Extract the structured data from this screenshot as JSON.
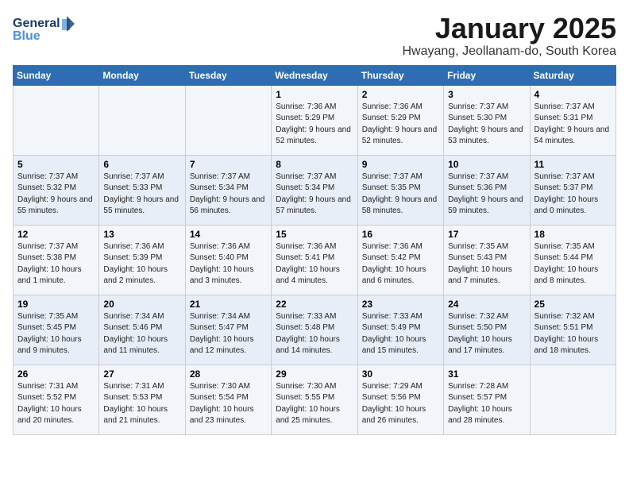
{
  "header": {
    "logo_line1": "General",
    "logo_line2": "Blue",
    "title": "January 2025",
    "subtitle": "Hwayang, Jeollanam-do, South Korea"
  },
  "weekdays": [
    "Sunday",
    "Monday",
    "Tuesday",
    "Wednesday",
    "Thursday",
    "Friday",
    "Saturday"
  ],
  "weeks": [
    [
      {
        "day": "",
        "info": ""
      },
      {
        "day": "",
        "info": ""
      },
      {
        "day": "",
        "info": ""
      },
      {
        "day": "1",
        "info": "Sunrise: 7:36 AM\nSunset: 5:29 PM\nDaylight: 9 hours and 52 minutes."
      },
      {
        "day": "2",
        "info": "Sunrise: 7:36 AM\nSunset: 5:29 PM\nDaylight: 9 hours and 52 minutes."
      },
      {
        "day": "3",
        "info": "Sunrise: 7:37 AM\nSunset: 5:30 PM\nDaylight: 9 hours and 53 minutes."
      },
      {
        "day": "4",
        "info": "Sunrise: 7:37 AM\nSunset: 5:31 PM\nDaylight: 9 hours and 54 minutes."
      }
    ],
    [
      {
        "day": "5",
        "info": "Sunrise: 7:37 AM\nSunset: 5:32 PM\nDaylight: 9 hours and 55 minutes."
      },
      {
        "day": "6",
        "info": "Sunrise: 7:37 AM\nSunset: 5:33 PM\nDaylight: 9 hours and 55 minutes."
      },
      {
        "day": "7",
        "info": "Sunrise: 7:37 AM\nSunset: 5:34 PM\nDaylight: 9 hours and 56 minutes."
      },
      {
        "day": "8",
        "info": "Sunrise: 7:37 AM\nSunset: 5:34 PM\nDaylight: 9 hours and 57 minutes."
      },
      {
        "day": "9",
        "info": "Sunrise: 7:37 AM\nSunset: 5:35 PM\nDaylight: 9 hours and 58 minutes."
      },
      {
        "day": "10",
        "info": "Sunrise: 7:37 AM\nSunset: 5:36 PM\nDaylight: 9 hours and 59 minutes."
      },
      {
        "day": "11",
        "info": "Sunrise: 7:37 AM\nSunset: 5:37 PM\nDaylight: 10 hours and 0 minutes."
      }
    ],
    [
      {
        "day": "12",
        "info": "Sunrise: 7:37 AM\nSunset: 5:38 PM\nDaylight: 10 hours and 1 minute."
      },
      {
        "day": "13",
        "info": "Sunrise: 7:36 AM\nSunset: 5:39 PM\nDaylight: 10 hours and 2 minutes."
      },
      {
        "day": "14",
        "info": "Sunrise: 7:36 AM\nSunset: 5:40 PM\nDaylight: 10 hours and 3 minutes."
      },
      {
        "day": "15",
        "info": "Sunrise: 7:36 AM\nSunset: 5:41 PM\nDaylight: 10 hours and 4 minutes."
      },
      {
        "day": "16",
        "info": "Sunrise: 7:36 AM\nSunset: 5:42 PM\nDaylight: 10 hours and 6 minutes."
      },
      {
        "day": "17",
        "info": "Sunrise: 7:35 AM\nSunset: 5:43 PM\nDaylight: 10 hours and 7 minutes."
      },
      {
        "day": "18",
        "info": "Sunrise: 7:35 AM\nSunset: 5:44 PM\nDaylight: 10 hours and 8 minutes."
      }
    ],
    [
      {
        "day": "19",
        "info": "Sunrise: 7:35 AM\nSunset: 5:45 PM\nDaylight: 10 hours and 9 minutes."
      },
      {
        "day": "20",
        "info": "Sunrise: 7:34 AM\nSunset: 5:46 PM\nDaylight: 10 hours and 11 minutes."
      },
      {
        "day": "21",
        "info": "Sunrise: 7:34 AM\nSunset: 5:47 PM\nDaylight: 10 hours and 12 minutes."
      },
      {
        "day": "22",
        "info": "Sunrise: 7:33 AM\nSunset: 5:48 PM\nDaylight: 10 hours and 14 minutes."
      },
      {
        "day": "23",
        "info": "Sunrise: 7:33 AM\nSunset: 5:49 PM\nDaylight: 10 hours and 15 minutes."
      },
      {
        "day": "24",
        "info": "Sunrise: 7:32 AM\nSunset: 5:50 PM\nDaylight: 10 hours and 17 minutes."
      },
      {
        "day": "25",
        "info": "Sunrise: 7:32 AM\nSunset: 5:51 PM\nDaylight: 10 hours and 18 minutes."
      }
    ],
    [
      {
        "day": "26",
        "info": "Sunrise: 7:31 AM\nSunset: 5:52 PM\nDaylight: 10 hours and 20 minutes."
      },
      {
        "day": "27",
        "info": "Sunrise: 7:31 AM\nSunset: 5:53 PM\nDaylight: 10 hours and 21 minutes."
      },
      {
        "day": "28",
        "info": "Sunrise: 7:30 AM\nSunset: 5:54 PM\nDaylight: 10 hours and 23 minutes."
      },
      {
        "day": "29",
        "info": "Sunrise: 7:30 AM\nSunset: 5:55 PM\nDaylight: 10 hours and 25 minutes."
      },
      {
        "day": "30",
        "info": "Sunrise: 7:29 AM\nSunset: 5:56 PM\nDaylight: 10 hours and 26 minutes."
      },
      {
        "day": "31",
        "info": "Sunrise: 7:28 AM\nSunset: 5:57 PM\nDaylight: 10 hours and 28 minutes."
      },
      {
        "day": "",
        "info": ""
      }
    ]
  ]
}
